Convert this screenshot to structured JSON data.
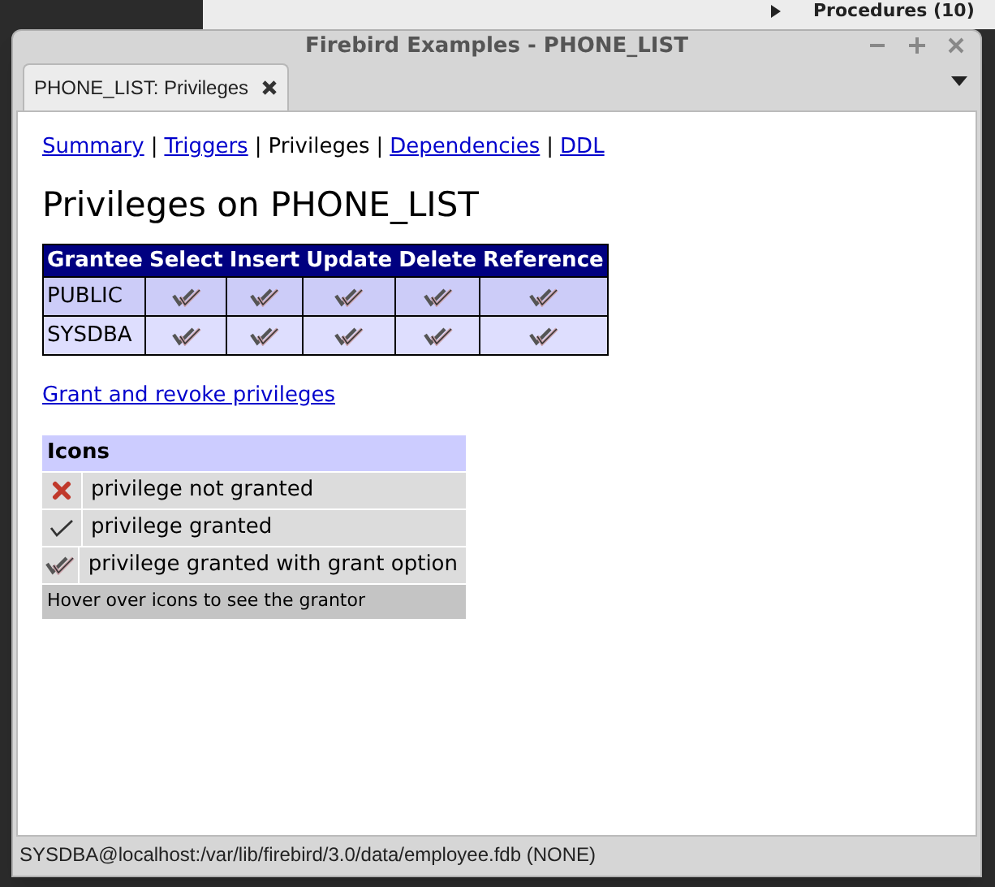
{
  "background": {
    "tree_item": "Procedures (10)"
  },
  "window": {
    "title": "Firebird Examples - PHONE_LIST"
  },
  "tabs": [
    {
      "label": "PHONE_LIST: Privileges",
      "selected": true
    }
  ],
  "nav": [
    {
      "label": "Summary",
      "kind": "link"
    },
    {
      "label": "|",
      "kind": "separator"
    },
    {
      "label": "Triggers",
      "kind": "link"
    },
    {
      "label": "|",
      "kind": "separator"
    },
    {
      "label": "Privileges",
      "kind": "current"
    },
    {
      "label": "|",
      "kind": "separator"
    },
    {
      "label": "Dependencies",
      "kind": "link"
    },
    {
      "label": "|",
      "kind": "separator"
    },
    {
      "label": "DDL",
      "kind": "link"
    }
  ],
  "heading": "Privileges on PHONE_LIST",
  "table": {
    "columns": [
      "Grantee",
      "Select",
      "Insert",
      "Update",
      "Delete",
      "Reference"
    ],
    "rows": [
      {
        "grantee": "PUBLIC",
        "cells": [
          {
            "kind": "grant_option"
          },
          {
            "kind": "grant_option"
          },
          {
            "kind": "grant_option"
          },
          {
            "kind": "grant_option"
          },
          {
            "kind": "grant_option"
          }
        ]
      },
      {
        "grantee": "SYSDBA",
        "cells": [
          {
            "kind": "grant_option"
          },
          {
            "kind": "grant_option"
          },
          {
            "kind": "grant_option"
          },
          {
            "kind": "grant_option"
          },
          {
            "kind": "grant_option"
          }
        ]
      }
    ]
  },
  "grant_link": "Grant and revoke privileges",
  "legend": {
    "title": "Icons",
    "items": [
      {
        "kind": "not_granted",
        "label": "privilege not granted"
      },
      {
        "kind": "granted",
        "label": "privilege granted"
      },
      {
        "kind": "grant_option",
        "label": "privilege granted with grant option"
      }
    ],
    "footer": "Hover over icons to see the grantor"
  },
  "status_bar": "SYSDBA@localhost:/var/lib/firebird/3.0/data/employee.fdb (NONE)"
}
